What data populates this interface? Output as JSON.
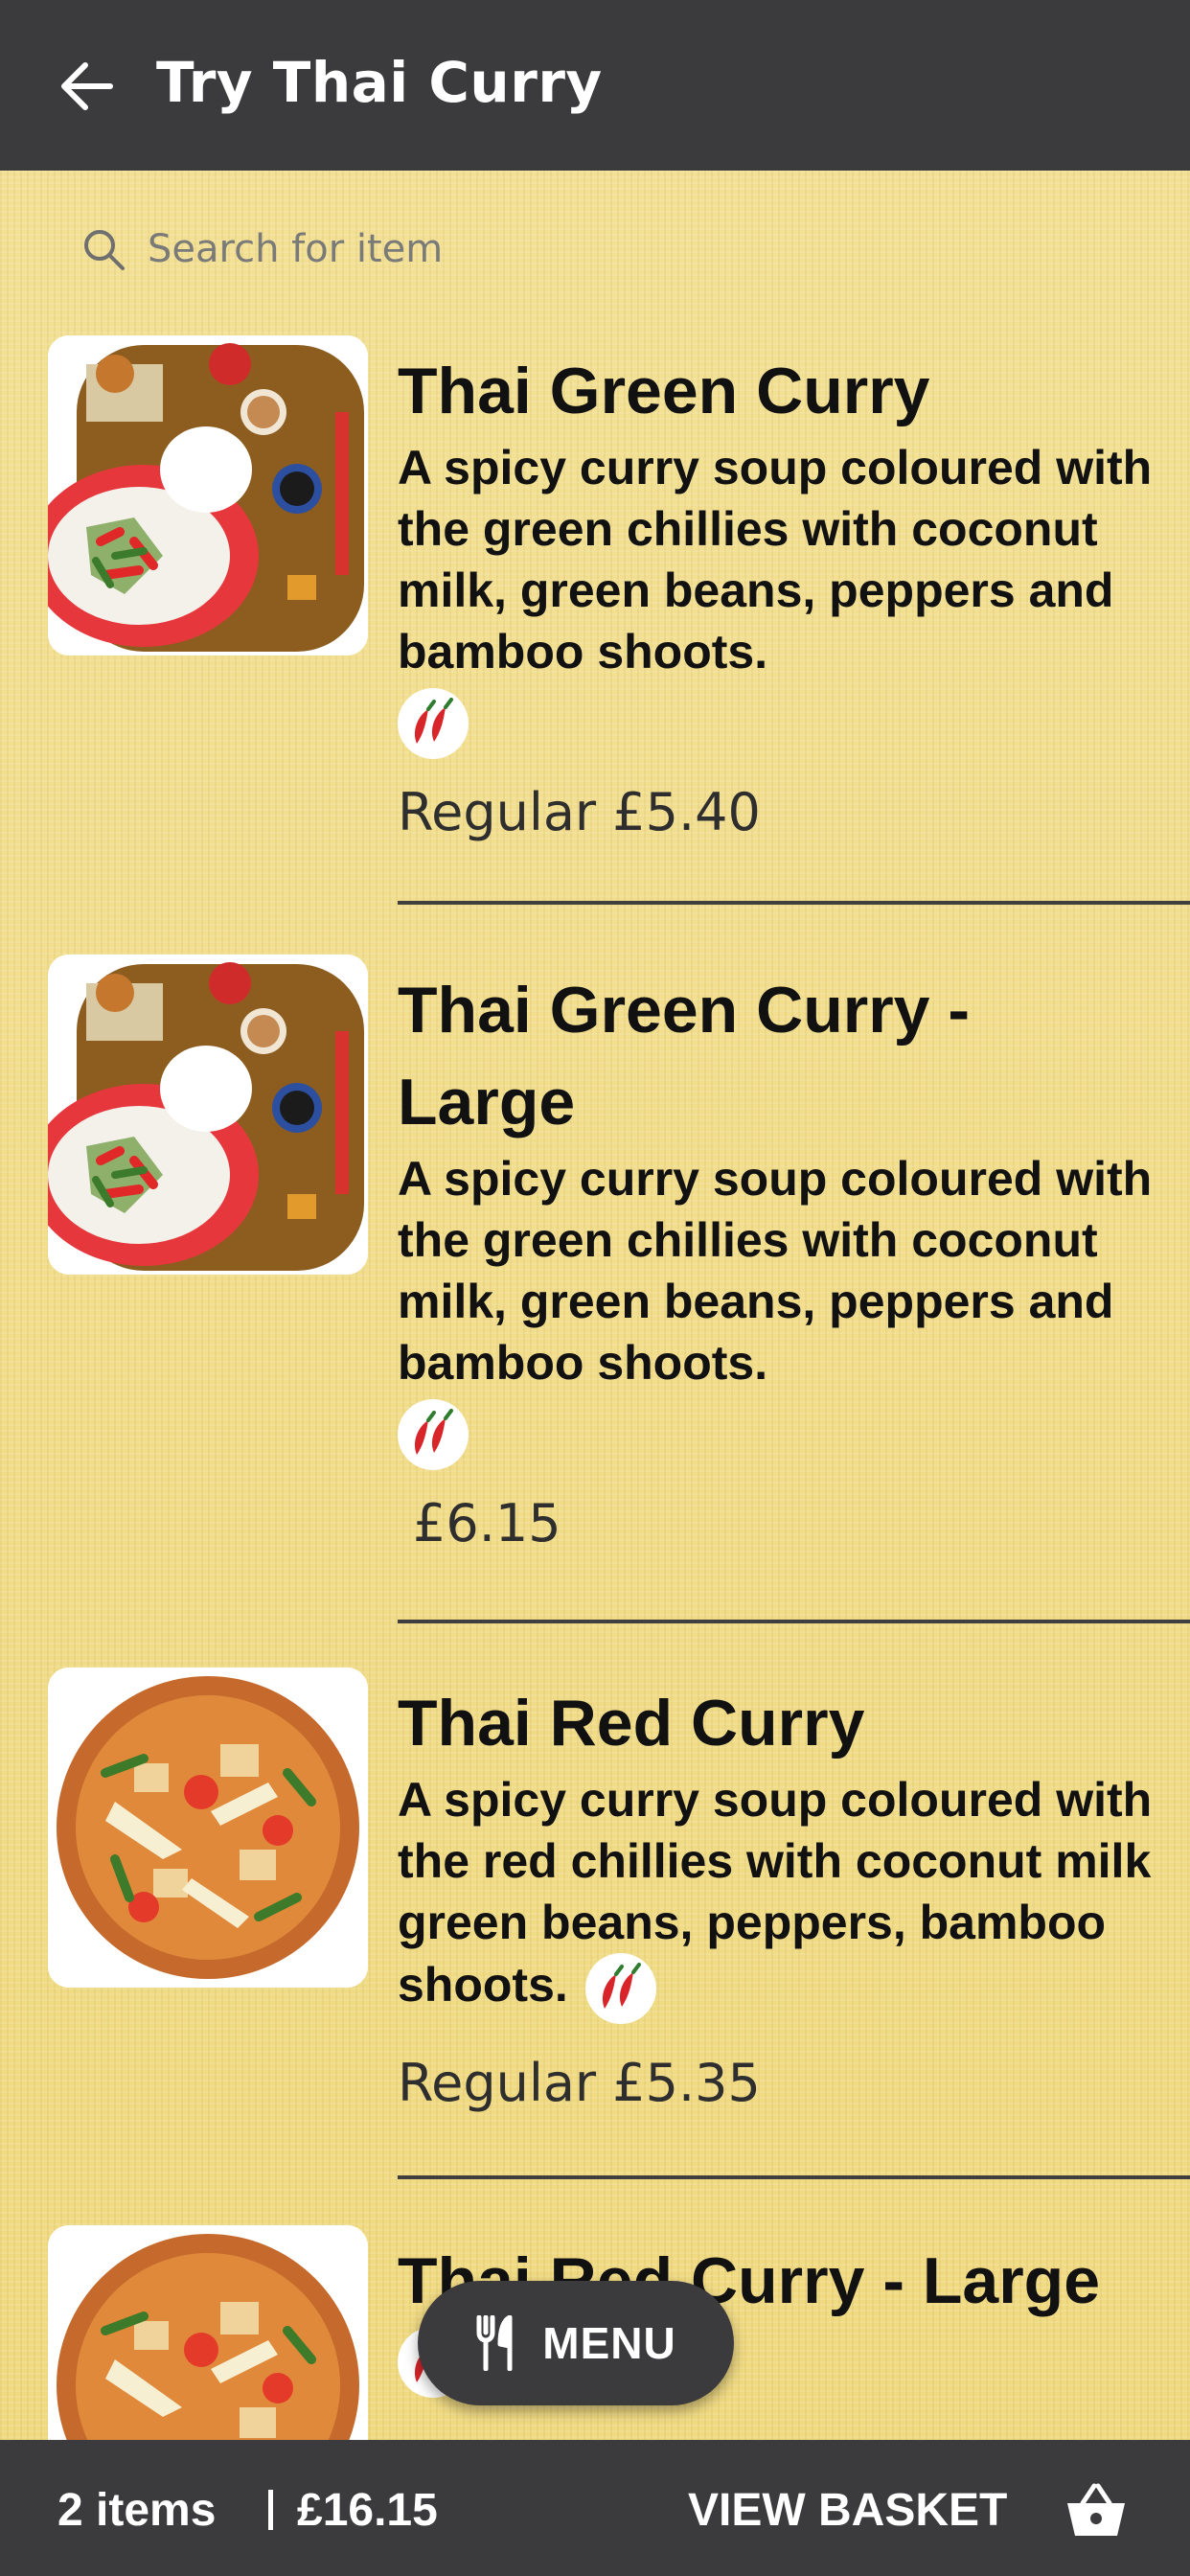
{
  "header": {
    "title": "Try Thai Curry",
    "back_icon": "arrow-left-icon",
    "background": "#3b3b3d"
  },
  "search": {
    "placeholder": "Search for item",
    "icon": "search-icon"
  },
  "items": [
    {
      "name": "Thai Green Curry",
      "description": "A spicy curry soup coloured with the green chillies with coconut milk, green beans, peppers and bamboo shoots.",
      "spice_icon": "chilli-icon",
      "price": "Regular £5.40",
      "image": "green-curry-plate"
    },
    {
      "name": "Thai Green Curry - Large",
      "description": "A spicy curry soup coloured with the green chillies with coconut milk, green beans, peppers and bamboo shoots.",
      "spice_icon": "chilli-icon",
      "price": "£6.15",
      "image": "green-curry-plate"
    },
    {
      "name": "Thai Red Curry",
      "description": "A spicy curry soup coloured with the red chillies with coconut milk green beans, peppers, bamboo shoots.",
      "spice_icon": "chilli-icon",
      "price": "Regular £5.35",
      "image": "red-curry-bowl"
    },
    {
      "name": "Thai Red Curry - Large",
      "image": "red-curry-bowl",
      "spice_icon": "chilli-icon"
    }
  ],
  "fab": {
    "label": "MENU",
    "icon": "fork-knife-icon"
  },
  "basket": {
    "count": "2 items",
    "total": "£16.15",
    "action": "VIEW BASKET",
    "icon": "basket-icon"
  },
  "colors": {
    "bar": "#3b3b3d",
    "background": "#f0dd88",
    "text": "#111111"
  }
}
